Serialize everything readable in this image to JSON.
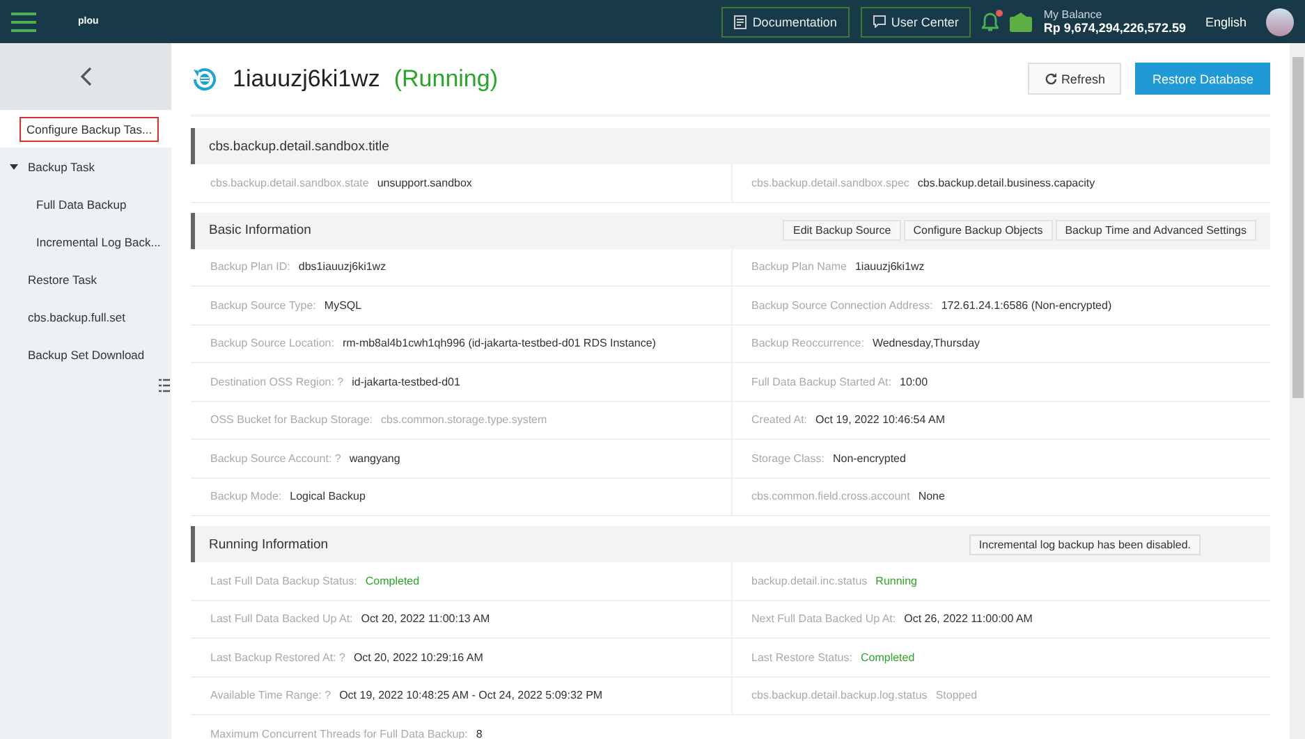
{
  "topbar": {
    "logo": "plou",
    "links": [
      {
        "label": "Documentation"
      },
      {
        "label": "User Center"
      }
    ],
    "notification": true,
    "balance": {
      "label": "My Balance",
      "value": "Rp 9,674,294,226,572.59"
    },
    "language": "English"
  },
  "sidebar": {
    "items": [
      {
        "label": "Configure Backup Tas...",
        "selected": true
      },
      {
        "label": "Backup Task",
        "selected": false,
        "expanded": true,
        "children": [
          {
            "label": "Full Data Backup",
            "selected": false
          },
          {
            "label": "Incremental Log Back...",
            "selected": false
          }
        ]
      },
      {
        "label": "Restore Task",
        "selected": false
      },
      {
        "label": "cbs.backup.full.set",
        "selected": false
      },
      {
        "label": "Backup Set Download",
        "selected": false
      }
    ]
  },
  "header": {
    "name": "1iauuzj6ki1wz",
    "status": "(Running)",
    "buttons": [
      {
        "label": "Refresh",
        "kind": "secondary"
      },
      {
        "label": "Restore Database",
        "kind": "primary"
      }
    ]
  },
  "sections": [
    {
      "title": "cbs.backup.detail.sandbox.title",
      "rows": [
        [
          {
            "label": "cbs.backup.detail.sandbox.state",
            "value": "unsupport.sandbox",
            "kind": "normal"
          },
          {
            "label": "cbs.backup.detail.sandbox.spec",
            "value": "cbs.backup.detail.business.capacity",
            "kind": "normal"
          }
        ]
      ]
    },
    {
      "title": "Basic Information",
      "actions": [
        "Edit Backup Source",
        "Configure Backup Objects",
        "Backup Time and Advanced Settings"
      ],
      "rows": [
        [
          {
            "label": "Backup Plan ID:",
            "value": "dbs1iauuzj6ki1wz",
            "kind": "normal"
          },
          {
            "label": "Backup Plan Name",
            "value": "1iauuzj6ki1wz",
            "kind": "normal"
          }
        ],
        [
          {
            "label": "Backup Source Type:",
            "value": "MySQL",
            "kind": "normal"
          },
          {
            "label": "Backup Source Connection Address:",
            "value": "172.61.24.1:6586   (Non-encrypted)",
            "kind": "normal"
          }
        ],
        [
          {
            "label": "Backup Source Location:",
            "value": "rm-mb8al4b1cwh1qh996 (id-jakarta-testbed-d01 RDS Instance)",
            "kind": "normal"
          },
          {
            "label": "Backup Reoccurrence:",
            "value": "Wednesday,Thursday",
            "kind": "normal"
          }
        ],
        [
          {
            "label": "Destination OSS Region: ?",
            "value": "id-jakarta-testbed-d01",
            "kind": "normal"
          },
          {
            "label": "Full Data Backup Started At:",
            "value": "10:00",
            "kind": "normal"
          }
        ],
        [
          {
            "label": "OSS Bucket for Backup Storage:",
            "value": "cbs.common.storage.type.system",
            "kind": "muted"
          },
          {
            "label": "Created At:",
            "value": "Oct 19, 2022 10:46:54 AM",
            "kind": "normal"
          }
        ],
        [
          {
            "label": "Backup Source Account: ?",
            "value": "wangyang",
            "kind": "normal"
          },
          {
            "label": "Storage Class:",
            "value": "Non-encrypted",
            "kind": "normal"
          }
        ],
        [
          {
            "label": "Backup Mode:",
            "value": "Logical Backup",
            "kind": "normal"
          },
          {
            "label": "cbs.common.field.cross.account",
            "value": "None",
            "kind": "normal"
          }
        ]
      ]
    },
    {
      "title": "Running Information",
      "note": "Incremental log backup has been disabled.",
      "rows": [
        [
          {
            "label": "Last Full Data Backup Status:",
            "value": "Completed",
            "kind": "success"
          },
          {
            "label": "backup.detail.inc.status",
            "value": "Running",
            "kind": "success"
          }
        ],
        [
          {
            "label": "Last Full Data Backed Up At:",
            "value": "Oct 20, 2022 11:00:13 AM",
            "kind": "normal"
          },
          {
            "label": "Next Full Data Backed Up At:",
            "value": "Oct 26, 2022 11:00:00 AM",
            "kind": "normal"
          }
        ],
        [
          {
            "label": "Last Backup Restored At: ?",
            "value": "Oct 20, 2022 10:29:16 AM",
            "kind": "normal"
          },
          {
            "label": "Last Restore Status:",
            "value": "Completed",
            "kind": "success"
          }
        ],
        [
          {
            "label": "Available Time Range: ?",
            "value": "Oct 19, 2022 10:48:25 AM - Oct 24, 2022 5:09:32 PM",
            "kind": "normal"
          },
          {
            "label": "cbs.backup.detail.backup.log.status",
            "value": "Stopped",
            "kind": "muted"
          }
        ],
        [
          {
            "label": "Maximum Concurrent Threads for Full Data Backup:",
            "value": "8",
            "kind": "normal"
          }
        ]
      ]
    }
  ]
}
